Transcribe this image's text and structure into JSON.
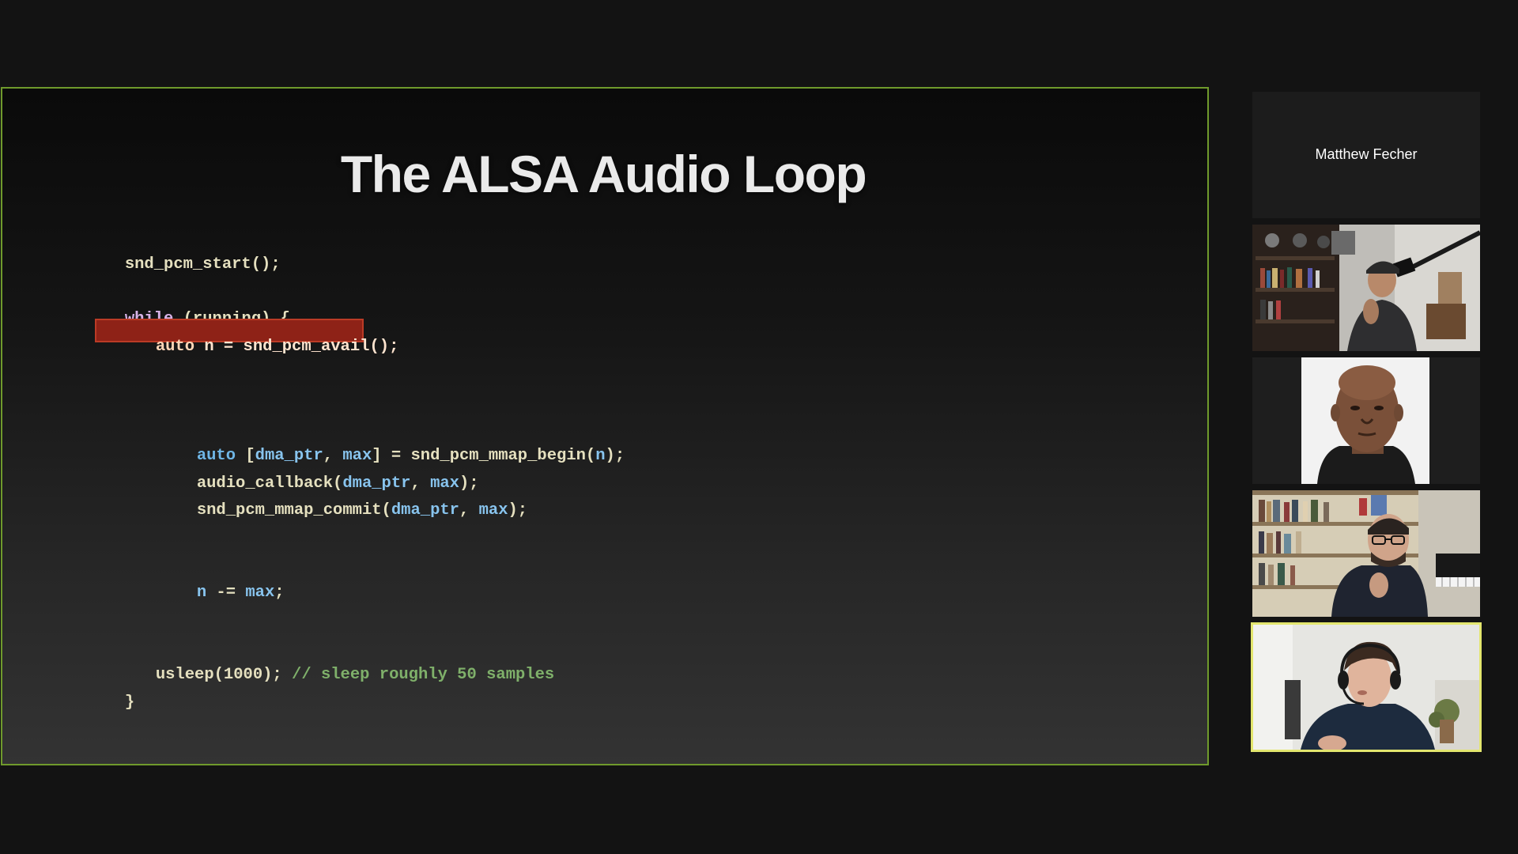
{
  "slide": {
    "title": "The ALSA Audio Loop",
    "code": {
      "line1": "snd_pcm_start();",
      "line2_kw": "while",
      "line2_rest": " (running) {",
      "line3_kw": "auto",
      "line3_rest": " n = snd_pcm_avail();",
      "line4_kw": "auto",
      "line4_open": " [",
      "line4_v1": "dma_ptr",
      "line4_sep": ", ",
      "line4_v2": "max",
      "line4_mid": "] = snd_pcm_mmap_begin(",
      "line4_v3": "n",
      "line4_end": ");",
      "line5_fn": "audio_callback(",
      "line5_v1": "dma_ptr",
      "line5_sep": ", ",
      "line5_v2": "max",
      "line5_end": ");",
      "line6_fn": "snd_pcm_mmap_commit(",
      "line6_v1": "dma_ptr",
      "line6_sep": ", ",
      "line6_v2": "max",
      "line6_end": ");",
      "line7_v1": "n",
      "line7_op": " -= ",
      "line7_v2": "max",
      "line7_end": ";",
      "line8_code": "usleep(1000); ",
      "line8_comment": "// sleep roughly 50 samples",
      "line9": "}"
    },
    "border_color": "#6f9a2c",
    "highlight_color": "#8e2217"
  },
  "participants": {
    "name_tile": "Matthew Fecher",
    "active_speaker_border": "#e3e66e"
  }
}
